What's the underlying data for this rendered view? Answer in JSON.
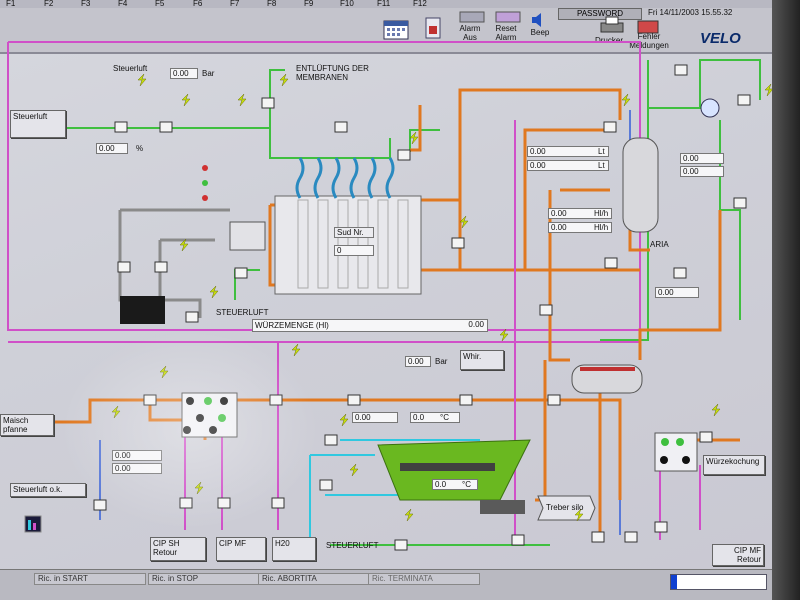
{
  "fkeys": [
    "F1",
    "F2",
    "F3",
    "F4",
    "F5",
    "F6",
    "F7",
    "F8",
    "F9",
    "F10",
    "F11",
    "F12"
  ],
  "header": {
    "alarm_aus": "Alarm Aus",
    "reset_alarm": "Reset Alarm",
    "beep": "Beep",
    "password": "PASSWORD",
    "datetime": "Fri 14/11/2003 15.55.32",
    "drucker": "Drucker",
    "fehler": "Fehler Meldungen",
    "logo": "VELO"
  },
  "labels": {
    "steuerluft_top": "Steuerluft",
    "bar_top": "0.00",
    "bar_unit": "Bar",
    "entluftung": "ENTLÜFTUNG DER MEMBRANEN",
    "steuerluft_btn": "Steuerluft",
    "pct_left": "0.00",
    "pct_unit": "%",
    "lt1": "0.00",
    "lt1_unit": "Lt",
    "lt2": "0.00",
    "lt2_unit": "Lt",
    "hlh1": "0.00",
    "hlh1_unit": "Hl/h",
    "hlh2": "0.00",
    "hlh2_unit": "Hl/h",
    "aria": "ARIA",
    "pct_r1": "0.00",
    "pct_r2": "0.00",
    "pct_r3": "0.00",
    "sud_nr": "Sud Nr.",
    "sud_val": "0",
    "steuerluft_mid": "STEUERLUFT",
    "wurzemenge": "WÜRZEMENGE (Hl)",
    "wurzemenge_val": "0.00",
    "bar_mid": "0.00",
    "bar_mid_unit": "Bar",
    "whir": "Whir.",
    "maisch": "Maisch pfanne",
    "pct_a": "0.00",
    "pct_b": "0.00",
    "pct_c": "0.00",
    "temp_c": "0.0",
    "temp_unit": "°C",
    "temp_low": "0.0",
    "temp_low_unit": "°C",
    "steuerluft_ok": "Steuerluft o.k.",
    "treber": "Treber silo",
    "wurzkochung": "Würzekochung",
    "cip_sh": "CIP SH Retour",
    "cip_mf": "CIP MF",
    "h2o": "H20",
    "steuerluft_bot": "STEUERLUFT",
    "cip_mf_right": "CIP MF Retour"
  },
  "status": [
    "Ric. in START",
    "Ric. in STOP",
    "Ric. ABORTITA",
    "Ric. TERMINATA"
  ],
  "colors": {
    "orange": "#e07820",
    "green": "#3fbf3f",
    "magenta": "#d050c8",
    "blue": "#5a7ad8",
    "cyan": "#30c8e0",
    "gray": "#8a8a8a",
    "vessel": "#d8d8dc"
  }
}
